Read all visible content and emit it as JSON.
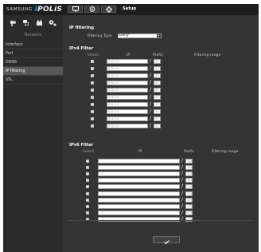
{
  "header": {
    "brand": "SAMSUNG",
    "product_prefix": "",
    "product_i": "i",
    "product_rest": "POLiS",
    "setup_title": "Setup",
    "nav_icons": [
      "monitor-icon",
      "camera-icon",
      "gear-icon"
    ]
  },
  "sidebar": {
    "category_icons": [
      "camera-settings-icon",
      "network-icon",
      "event-icon",
      "system-icon"
    ],
    "section_label": "Network",
    "items": [
      {
        "label": "Interface",
        "active": false
      },
      {
        "label": "Port",
        "active": false
      },
      {
        "label": "DDNS",
        "active": false
      },
      {
        "label": "IP filtering",
        "active": true
      },
      {
        "label": "SSL",
        "active": false
      }
    ]
  },
  "ip_filtering": {
    "title": "IP filtering",
    "filtering_type_label": "Filtering Type",
    "filtering_type_value": "Deny"
  },
  "ipv4_filter": {
    "title": "IPv4 Filter",
    "headers": {
      "select": "Select",
      "ip": "IP",
      "prefix": "Prefix",
      "range": "Filtering range"
    },
    "rows": [
      {
        "ip": "0.0.0.0",
        "prefix": "32"
      },
      {
        "ip": "0.0.0.0",
        "prefix": "32"
      },
      {
        "ip": "0.0.0.0",
        "prefix": "32"
      },
      {
        "ip": "0.0.0.0",
        "prefix": "32"
      },
      {
        "ip": "0.0.0.0",
        "prefix": "32"
      },
      {
        "ip": "0.0.0.0",
        "prefix": "32"
      },
      {
        "ip": "0.0.0.0",
        "prefix": "32"
      },
      {
        "ip": "0.0.0.0",
        "prefix": "32"
      },
      {
        "ip": "0.0.0.0",
        "prefix": "32"
      },
      {
        "ip": "0.0.0.0",
        "prefix": "32"
      }
    ]
  },
  "ipv6_filter": {
    "title": "IPv6 Filter",
    "headers": {
      "select": "Select",
      "ip": "IP",
      "prefix": "Prefix",
      "range": "Filtering range"
    },
    "rows": [
      {
        "ip": "",
        "prefix": "128"
      },
      {
        "ip": "",
        "prefix": "128"
      },
      {
        "ip": "",
        "prefix": "128"
      },
      {
        "ip": "",
        "prefix": "128"
      },
      {
        "ip": "",
        "prefix": "128"
      },
      {
        "ip": "",
        "prefix": "128"
      },
      {
        "ip": "",
        "prefix": "128"
      },
      {
        "ip": "",
        "prefix": "128"
      },
      {
        "ip": "",
        "prefix": "128"
      },
      {
        "ip": "",
        "prefix": "128"
      }
    ]
  },
  "footer": {
    "apply_icon": "checkmark-icon"
  },
  "colors": {
    "accent": "#19a3e0",
    "panel": "#343434",
    "sidebar": "#2b2b2b",
    "active_item": "#585858"
  }
}
